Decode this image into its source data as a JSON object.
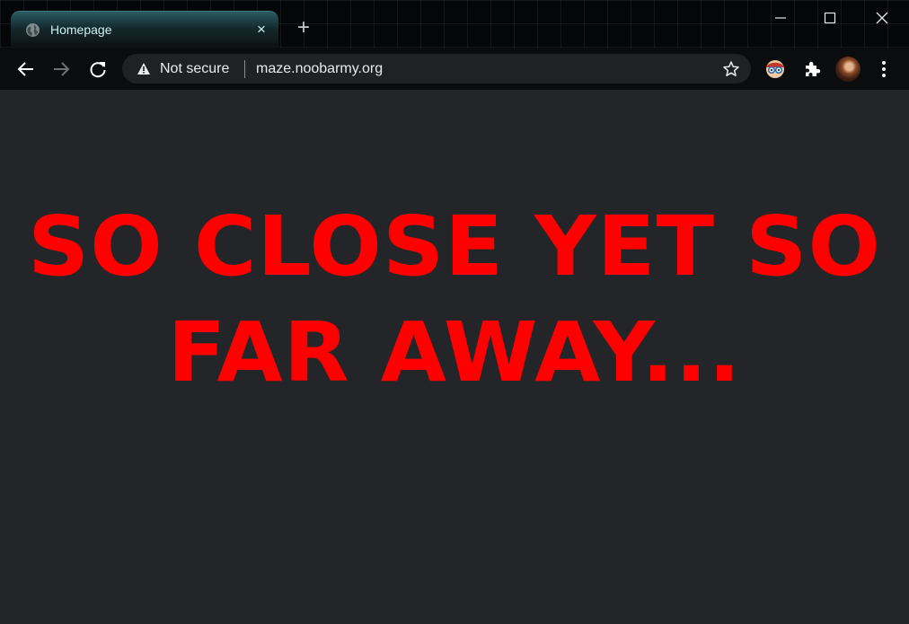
{
  "tab": {
    "title": "Homepage",
    "favicon": "globe-icon",
    "close": "×"
  },
  "new_tab": "+",
  "address_bar": {
    "security_label": "Not secure",
    "url": "maze.noobarmy.org"
  },
  "page": {
    "headline_line1": "SO CLOSE YET SO",
    "headline_line2": "FAR AWAY..."
  },
  "colors": {
    "headline": "#ff0000",
    "page_background": "#232528",
    "toolbar": "#0b0c0d"
  }
}
